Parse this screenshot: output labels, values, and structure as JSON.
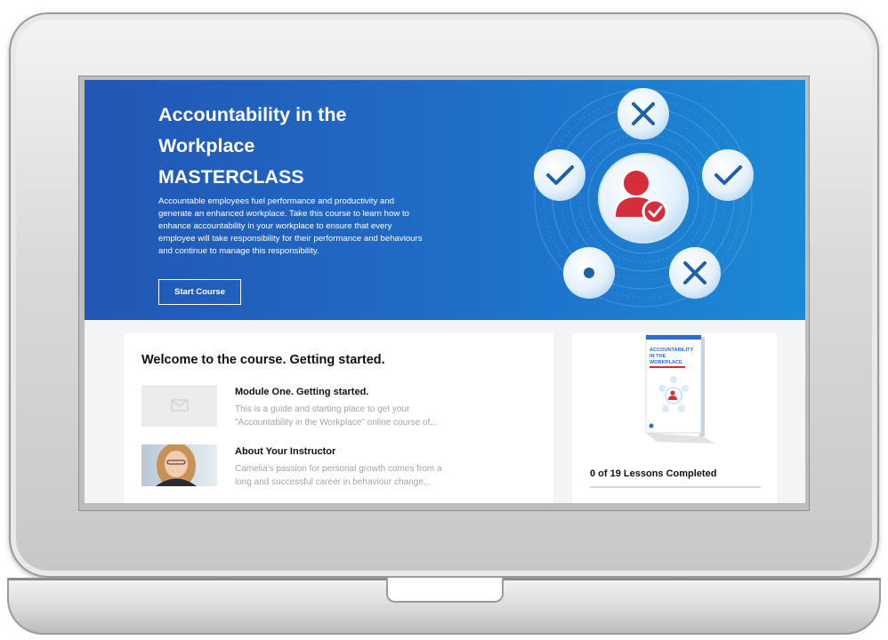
{
  "hero": {
    "title_line1": "Accountability in the",
    "title_line2": "Workplace",
    "title_line3": "MASTERCLASS",
    "description": "Accountable employees fuel performance and productivity and generate an enhanced workplace. Take this course to learn how to enhance accountability in your workplace to ensure that every employee will take responsibility for their performance and behaviours and continue to manage this responsibility.",
    "cta_label": "Start Course"
  },
  "welcome": {
    "heading": "Welcome to the course. Getting started.",
    "items": [
      {
        "title": "Module One. Getting started.",
        "desc_line1": "This is a guide and starting place to get your",
        "desc_line2": "\"Accountability in the Workplace\" online course of..."
      },
      {
        "title": "About Your Instructor",
        "desc_line1": "Camelia's passion for personal growth comes from a",
        "desc_line2": "long and successful career in behaviour change..."
      }
    ]
  },
  "book": {
    "title_line1": "ACCOUNTABILITY",
    "title_line2": "IN THE",
    "title_line3": "WORKPLACE"
  },
  "progress": {
    "label": "0 of 19 Lessons Completed",
    "completed": 0,
    "total": 19
  },
  "colors": {
    "hero_start": "#2356b5",
    "hero_end": "#1b8ad6",
    "icon_blue": "#1f5fa8",
    "person_red": "#d62d3a"
  },
  "icons": {
    "orbit": [
      "x-icon",
      "check-icon",
      "check-icon",
      "circle-dot-icon",
      "x-icon"
    ],
    "center": "person-check-icon"
  }
}
